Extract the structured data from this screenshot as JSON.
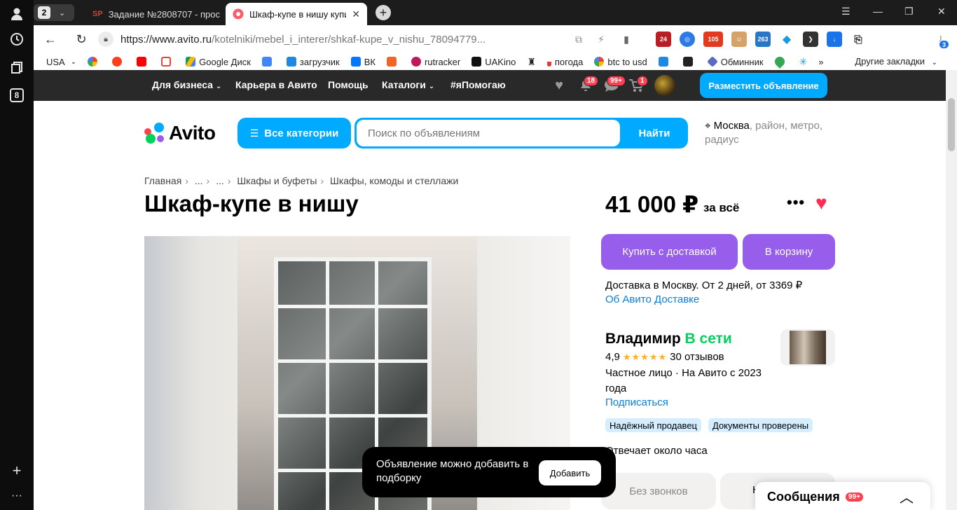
{
  "browser": {
    "tab_group_count": "2",
    "tabs": [
      {
        "label": "Задание №2808707 - прос",
        "icon": "SP"
      },
      {
        "label": "Шкаф-купе в нишу купи",
        "icon": "avito-favicon",
        "active": true
      }
    ],
    "tab_close": "✕",
    "url_host": "https://www.avito.ru",
    "url_path": "/kotelniki/mebel_i_interer/shkaf-kupe_v_nishu_78094779...",
    "sidebar_badge": "8",
    "extension_badge": "3",
    "bookmarks": [
      {
        "label": "USA",
        "dropdown": true
      },
      {
        "label": "",
        "icon": "google-icon"
      },
      {
        "label": "",
        "icon": "yandex-icon"
      },
      {
        "label": "",
        "icon": "youtube-icon"
      },
      {
        "label": "",
        "icon": "gmail-icon"
      },
      {
        "label": "Google Диск",
        "icon": "drive-icon"
      },
      {
        "label": "",
        "icon": "translate-icon"
      },
      {
        "label": "загрузчик",
        "icon": "loader-icon"
      },
      {
        "label": "ВК",
        "icon": "vk-icon"
      },
      {
        "label": "",
        "icon": "f-icon"
      },
      {
        "label": "rutracker",
        "icon": "rutracker-icon"
      },
      {
        "label": "UAKino",
        "icon": "uakino-icon"
      },
      {
        "label": "",
        "icon": "chess-icon"
      },
      {
        "label": "погода",
        "icon": "thermometer-icon"
      },
      {
        "label": "btc to usd",
        "icon": "google-icon"
      },
      {
        "label": "",
        "icon": "p-icon"
      },
      {
        "label": "",
        "icon": "bc-icon"
      },
      {
        "label": "Обминник",
        "icon": "exchange-icon"
      },
      {
        "label": "",
        "icon": "maps-icon"
      },
      {
        "label": "",
        "icon": "star-icon"
      }
    ],
    "bookmarks_more": "»",
    "other_bookmarks": "Другие закладки"
  },
  "topnav": {
    "links": [
      "Для бизнеса",
      "Карьера в Авито",
      "Помощь",
      "Каталоги",
      "#яПомогаю"
    ],
    "notifications_badge": "18",
    "messages_badge": "99+",
    "cart_badge": "1",
    "post_button": "Разместить объявление"
  },
  "header": {
    "logo": "Avito",
    "categories_button": "Все категории",
    "search_placeholder": "Поиск по объявлениям",
    "search_button": "Найти",
    "location_city": "Москва",
    "location_rest": ", район, метро, радиус"
  },
  "listing": {
    "breadcrumbs": [
      "Главная",
      "...",
      "...",
      "Шкафы и буфеты",
      "Шкафы, комоды и стеллажи"
    ],
    "title": "Шкаф-купе в нишу",
    "price": "41 000 ₽",
    "price_suffix": "за всё",
    "more": "•••",
    "buy_button": "Купить с доставкой",
    "cart_button": "В корзину",
    "delivery_text": "Доставка в Москву. От 2 дней, от 3369 ₽",
    "delivery_link": "Об Авито Доставке",
    "no_calls_button": "Без звонков",
    "partial_button": "Н"
  },
  "seller": {
    "name": "Владимир",
    "status": "В сети",
    "rating": "4,9",
    "stars": "★★★★★",
    "reviews": "30 отзывов",
    "info": "Частное лицо · На Авито с 2023 года",
    "subscribe": "Подписаться",
    "tags": [
      "Надёжный продавец",
      "Документы проверены"
    ],
    "reply_time": "Отвечает около часа"
  },
  "toast": {
    "text": "Объявление можно добавить в подборку",
    "button": "Добавить"
  },
  "messages_panel": {
    "label": "Сообщения",
    "badge": "99+"
  },
  "colors": {
    "avito_blue": "#00aaff",
    "buy_purple": "#965eeb",
    "link_blue": "#0a7ed8",
    "online_green": "#02d15c",
    "heart_red": "#ff2d55"
  }
}
